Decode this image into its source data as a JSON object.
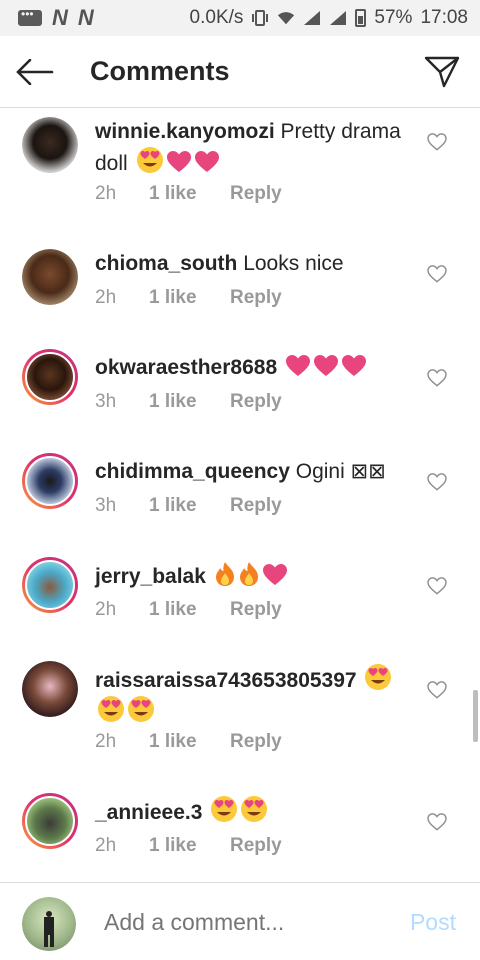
{
  "status_bar": {
    "network_speed": "0.0K/s",
    "battery": "57%",
    "time": "17:08",
    "n1": "N",
    "n2": "N"
  },
  "header": {
    "title": "Comments",
    "back_icon": "arrow-left-icon",
    "send_icon": "paper-plane-icon"
  },
  "comments": [
    {
      "user": "winnie.kanyomozi",
      "text": "Pretty drama doll",
      "emojis": [
        "heart-eyes",
        "pink-heart",
        "pink-heart"
      ],
      "time": "2h",
      "likes": "1 like",
      "reply": "Reply",
      "ring": false
    },
    {
      "user": "chioma_south",
      "text": "Looks nice",
      "emojis": [],
      "time": "2h",
      "likes": "1 like",
      "reply": "Reply",
      "ring": false
    },
    {
      "user": "okwaraesther8688",
      "text": "",
      "emojis": [
        "pink-heart",
        "pink-heart",
        "pink-heart"
      ],
      "time": "3h",
      "likes": "1 like",
      "reply": "Reply",
      "ring": true
    },
    {
      "user": "chidimma_queency",
      "text": "Ogini ⊠⊠",
      "emojis": [],
      "time": "3h",
      "likes": "1 like",
      "reply": "Reply",
      "ring": true
    },
    {
      "user": "jerry_balak",
      "text": "",
      "emojis": [
        "fire",
        "fire",
        "pink-heart"
      ],
      "time": "2h",
      "likes": "1 like",
      "reply": "Reply",
      "ring": true
    },
    {
      "user": "raissaraissa743653805397",
      "text": "",
      "emojis": [
        "heart-eyes",
        "heart-eyes",
        "heart-eyes"
      ],
      "time": "2h",
      "likes": "1 like",
      "reply": "Reply",
      "ring": false
    },
    {
      "user": "_annieee.3",
      "text": "",
      "emojis": [
        "heart-eyes",
        "heart-eyes"
      ],
      "time": "2h",
      "likes": "1 like",
      "reply": "Reply",
      "ring": true
    }
  ],
  "composer": {
    "placeholder": "Add a comment...",
    "post_label": "Post"
  },
  "colors": {
    "link_blue_disabled": "#b3dbff",
    "meta_gray": "#999999",
    "heart_pink": "#e8457f",
    "divider": "#dbdbdb"
  }
}
